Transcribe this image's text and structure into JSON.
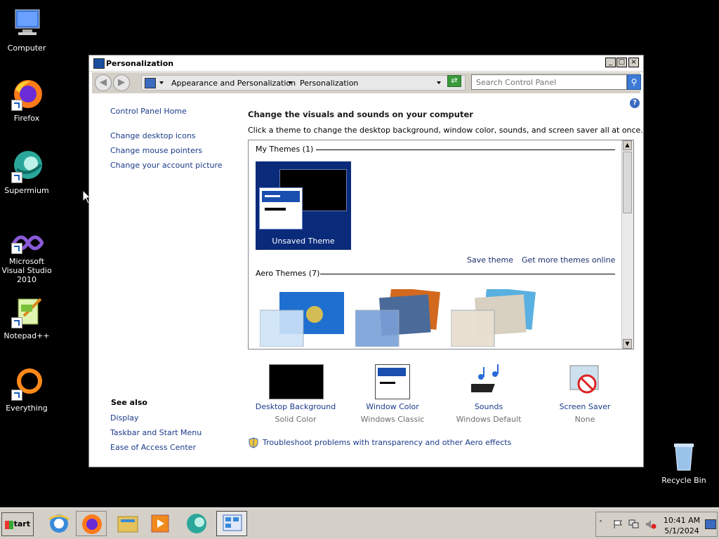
{
  "desktop": {
    "icons": [
      {
        "label": "Computer"
      },
      {
        "label": "Firefox"
      },
      {
        "label": "Supermium"
      },
      {
        "label": "Microsoft Visual Studio 2010"
      },
      {
        "label": "Notepad++"
      },
      {
        "label": "Everything"
      },
      {
        "label": "Recycle Bin"
      }
    ]
  },
  "window": {
    "title": "Personalization",
    "address": {
      "crumb1": "Appearance and Personalization",
      "crumb2": "Personalization"
    },
    "search": {
      "placeholder": "Search Control Panel"
    },
    "help": "?",
    "left_nav": {
      "home": "Control Panel Home",
      "links": [
        "Change desktop icons",
        "Change mouse pointers",
        "Change your account picture"
      ],
      "see_also_title": "See also",
      "see_also": [
        "Display",
        "Taskbar and Start Menu",
        "Ease of Access Center"
      ]
    },
    "main": {
      "heading": "Change the visuals and sounds on your computer",
      "subheading": "Click a theme to change the desktop background, window color, sounds, and screen saver all at once.",
      "my_themes_title": "My Themes (1)",
      "unsaved_theme": "Unsaved Theme",
      "save_theme": "Save theme",
      "get_more": "Get more themes online",
      "aero_title": "Aero Themes (7)",
      "categories": [
        {
          "title": "Desktop Background",
          "sub": "Solid Color"
        },
        {
          "title": "Window Color",
          "sub": "Windows Classic"
        },
        {
          "title": "Sounds",
          "sub": "Windows Default"
        },
        {
          "title": "Screen Saver",
          "sub": "None"
        }
      ],
      "troubleshoot": "Troubleshoot problems with transparency and other Aero effects"
    }
  },
  "taskbar": {
    "start_label": "Start",
    "time": "10:41 AM",
    "date": "5/1/2024"
  }
}
